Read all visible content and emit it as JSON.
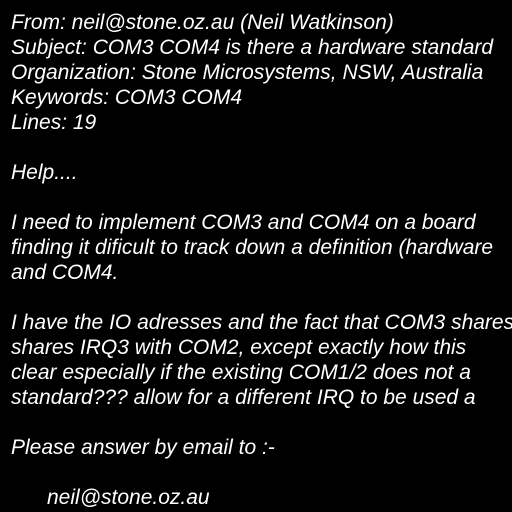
{
  "header": {
    "from": "From: neil@stone.oz.au (Neil Watkinson)",
    "subject": "Subject: COM3 COM4 is there a hardware standard",
    "organization": "Organization: Stone Microsystems, NSW, Australia",
    "keywords": "Keywords: COM3 COM4",
    "lines": "Lines: 19"
  },
  "body": {
    "greeting": "Help....",
    "para1": [
      "I need to implement COM3 and COM4 on a board",
      "finding it dificult to track down a definition (hardware",
      "and COM4."
    ],
    "para2": [
      "I have the IO adresses and the fact that COM3 shares",
      "shares IRQ3 with COM2, except exactly how this",
      "clear especially if the existing COM1/2 does not a",
      "standard??? allow for a different IRQ to be used a"
    ],
    "reply_prompt": "Please answer by email to :-",
    "reply_email": "neil@stone.oz.au"
  },
  "colors": {
    "background": "#000000",
    "text": "#ffffff"
  }
}
